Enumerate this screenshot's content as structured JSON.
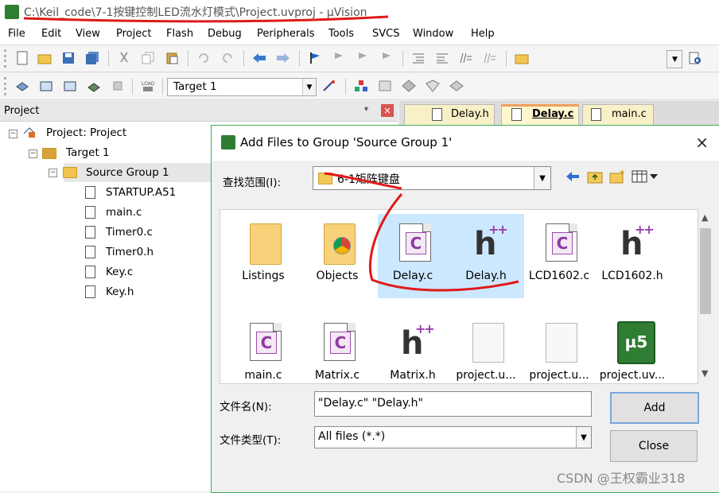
{
  "window": {
    "title": "C:\\Keil_code\\7-1按键控制LED流水灯模式\\Project.uvproj - µVision",
    "app_icon": "uvision-icon"
  },
  "menu": [
    "File",
    "Edit",
    "View",
    "Project",
    "Flash",
    "Debug",
    "Peripherals",
    "Tools",
    "SVCS",
    "Window",
    "Help"
  ],
  "toolbar2": {
    "target_select": "Target 1"
  },
  "project_panel": {
    "title": "Project",
    "pin": "ᵠ",
    "close": "×",
    "tree": {
      "project": "Project: Project",
      "target": "Target 1",
      "group": "Source Group 1",
      "files": [
        "STARTUP.A51",
        "main.c",
        "Timer0.c",
        "Timer0.h",
        "Key.c",
        "Key.h"
      ]
    }
  },
  "editor_tabs": [
    "Delay.h",
    "Delay.c",
    "main.c"
  ],
  "dialog": {
    "title": "Add Files to Group 'Source Group 1'",
    "look_in_label": "查找范围(I):",
    "look_in_value": "6-1矩阵键盘",
    "items": [
      {
        "name": "Listings",
        "type": "folder"
      },
      {
        "name": "Objects",
        "type": "folder-chrome"
      },
      {
        "name": "Delay.c",
        "type": "c"
      },
      {
        "name": "Delay.h",
        "type": "h"
      },
      {
        "name": "LCD1602.c",
        "type": "c"
      },
      {
        "name": "LCD1602.h",
        "type": "h"
      },
      {
        "name": "main.c",
        "type": "c"
      },
      {
        "name": "Matrix.c",
        "type": "c"
      },
      {
        "name": "Matrix.h",
        "type": "h"
      },
      {
        "name": "project.u...",
        "type": "plain"
      },
      {
        "name": "project.u...",
        "type": "plain"
      },
      {
        "name": "project.uv...",
        "type": "uv5"
      }
    ],
    "uv5_badge": "µ5",
    "c_glyph": "C",
    "h_glyph": "h",
    "h_plus": "++",
    "filename_label": "文件名(N):",
    "filename_value": "\"Delay.c\" \"Delay.h\"",
    "filetype_label": "文件类型(T):",
    "filetype_value": "All files (*.*)",
    "add_button": "Add",
    "close_button": "Close",
    "close_icon": "×"
  },
  "watermark": "CSDN @王权霸业318",
  "colors": {
    "accent_green": "#2e7d32",
    "selection": "#cce8ff",
    "annotation_red": "#e01919"
  }
}
